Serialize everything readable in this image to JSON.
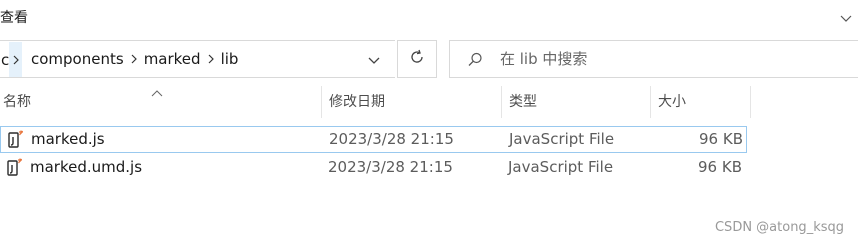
{
  "ribbon": {
    "view_label": "查看"
  },
  "address": {
    "cut_text": "c",
    "crumbs": [
      "components",
      "marked",
      "lib"
    ]
  },
  "search": {
    "placeholder": "在 lib 中搜索"
  },
  "columns": {
    "name": "名称",
    "modified": "修改日期",
    "type": "类型",
    "size": "大小"
  },
  "files": [
    {
      "name": "marked.js",
      "modified": "2023/3/28 21:15",
      "type": "JavaScript File",
      "size": "96 KB",
      "selected": true
    },
    {
      "name": "marked.umd.js",
      "modified": "2023/3/28 21:15",
      "type": "JavaScript File",
      "size": "96 KB",
      "selected": false
    }
  ],
  "icons": {
    "file": "javascript-file-icon",
    "refresh": "refresh-icon",
    "search": "search-icon",
    "dropdown": "chevron-down-icon"
  },
  "colors": {
    "selection_border": "#99c9ef",
    "sep_highlight": "#e5f1fb"
  },
  "watermark": "CSDN @atong_ksqg"
}
